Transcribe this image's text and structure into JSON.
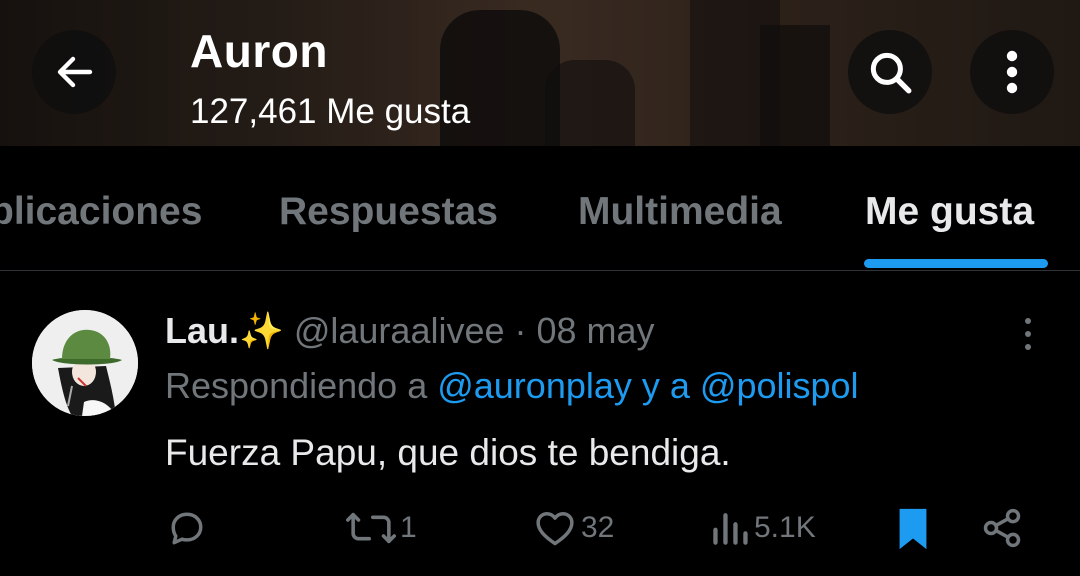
{
  "header": {
    "profile_name": "Auron",
    "likes_count": "127,461 Me gusta",
    "icons": {
      "back": "arrow-left-icon",
      "search": "search-icon",
      "more": "more-vertical-icon"
    }
  },
  "tabs": [
    {
      "label": "plicaciones",
      "active": false
    },
    {
      "label": "Respuestas",
      "active": false
    },
    {
      "label": "Multimedia",
      "active": false
    },
    {
      "label": "Me gusta",
      "active": true
    }
  ],
  "post": {
    "author_name": "Lau.",
    "author_emoji": "✨",
    "handle_time": " @lauraalivee · 08 may",
    "reply_prefix": "Respondiendo a ",
    "reply_mentions": "@auronplay y a @polispol",
    "text": "Fuerza Papu, que dios te bendiga.",
    "actions": {
      "reply": {
        "icon": "reply-icon",
        "count": ""
      },
      "repost": {
        "icon": "repost-icon",
        "count": "1"
      },
      "like": {
        "icon": "heart-icon",
        "count": "32"
      },
      "views": {
        "icon": "views-icon",
        "count": "5.1K"
      },
      "bookmark": {
        "icon": "bookmark-icon",
        "active": true
      },
      "share": {
        "icon": "share-icon"
      }
    }
  },
  "colors": {
    "accent": "#1d9bf0",
    "background": "#000000",
    "text_primary": "#e7e9ea",
    "text_secondary": "#71767b",
    "divider": "#2f3336",
    "avatar_hat": "#4f7a38"
  }
}
